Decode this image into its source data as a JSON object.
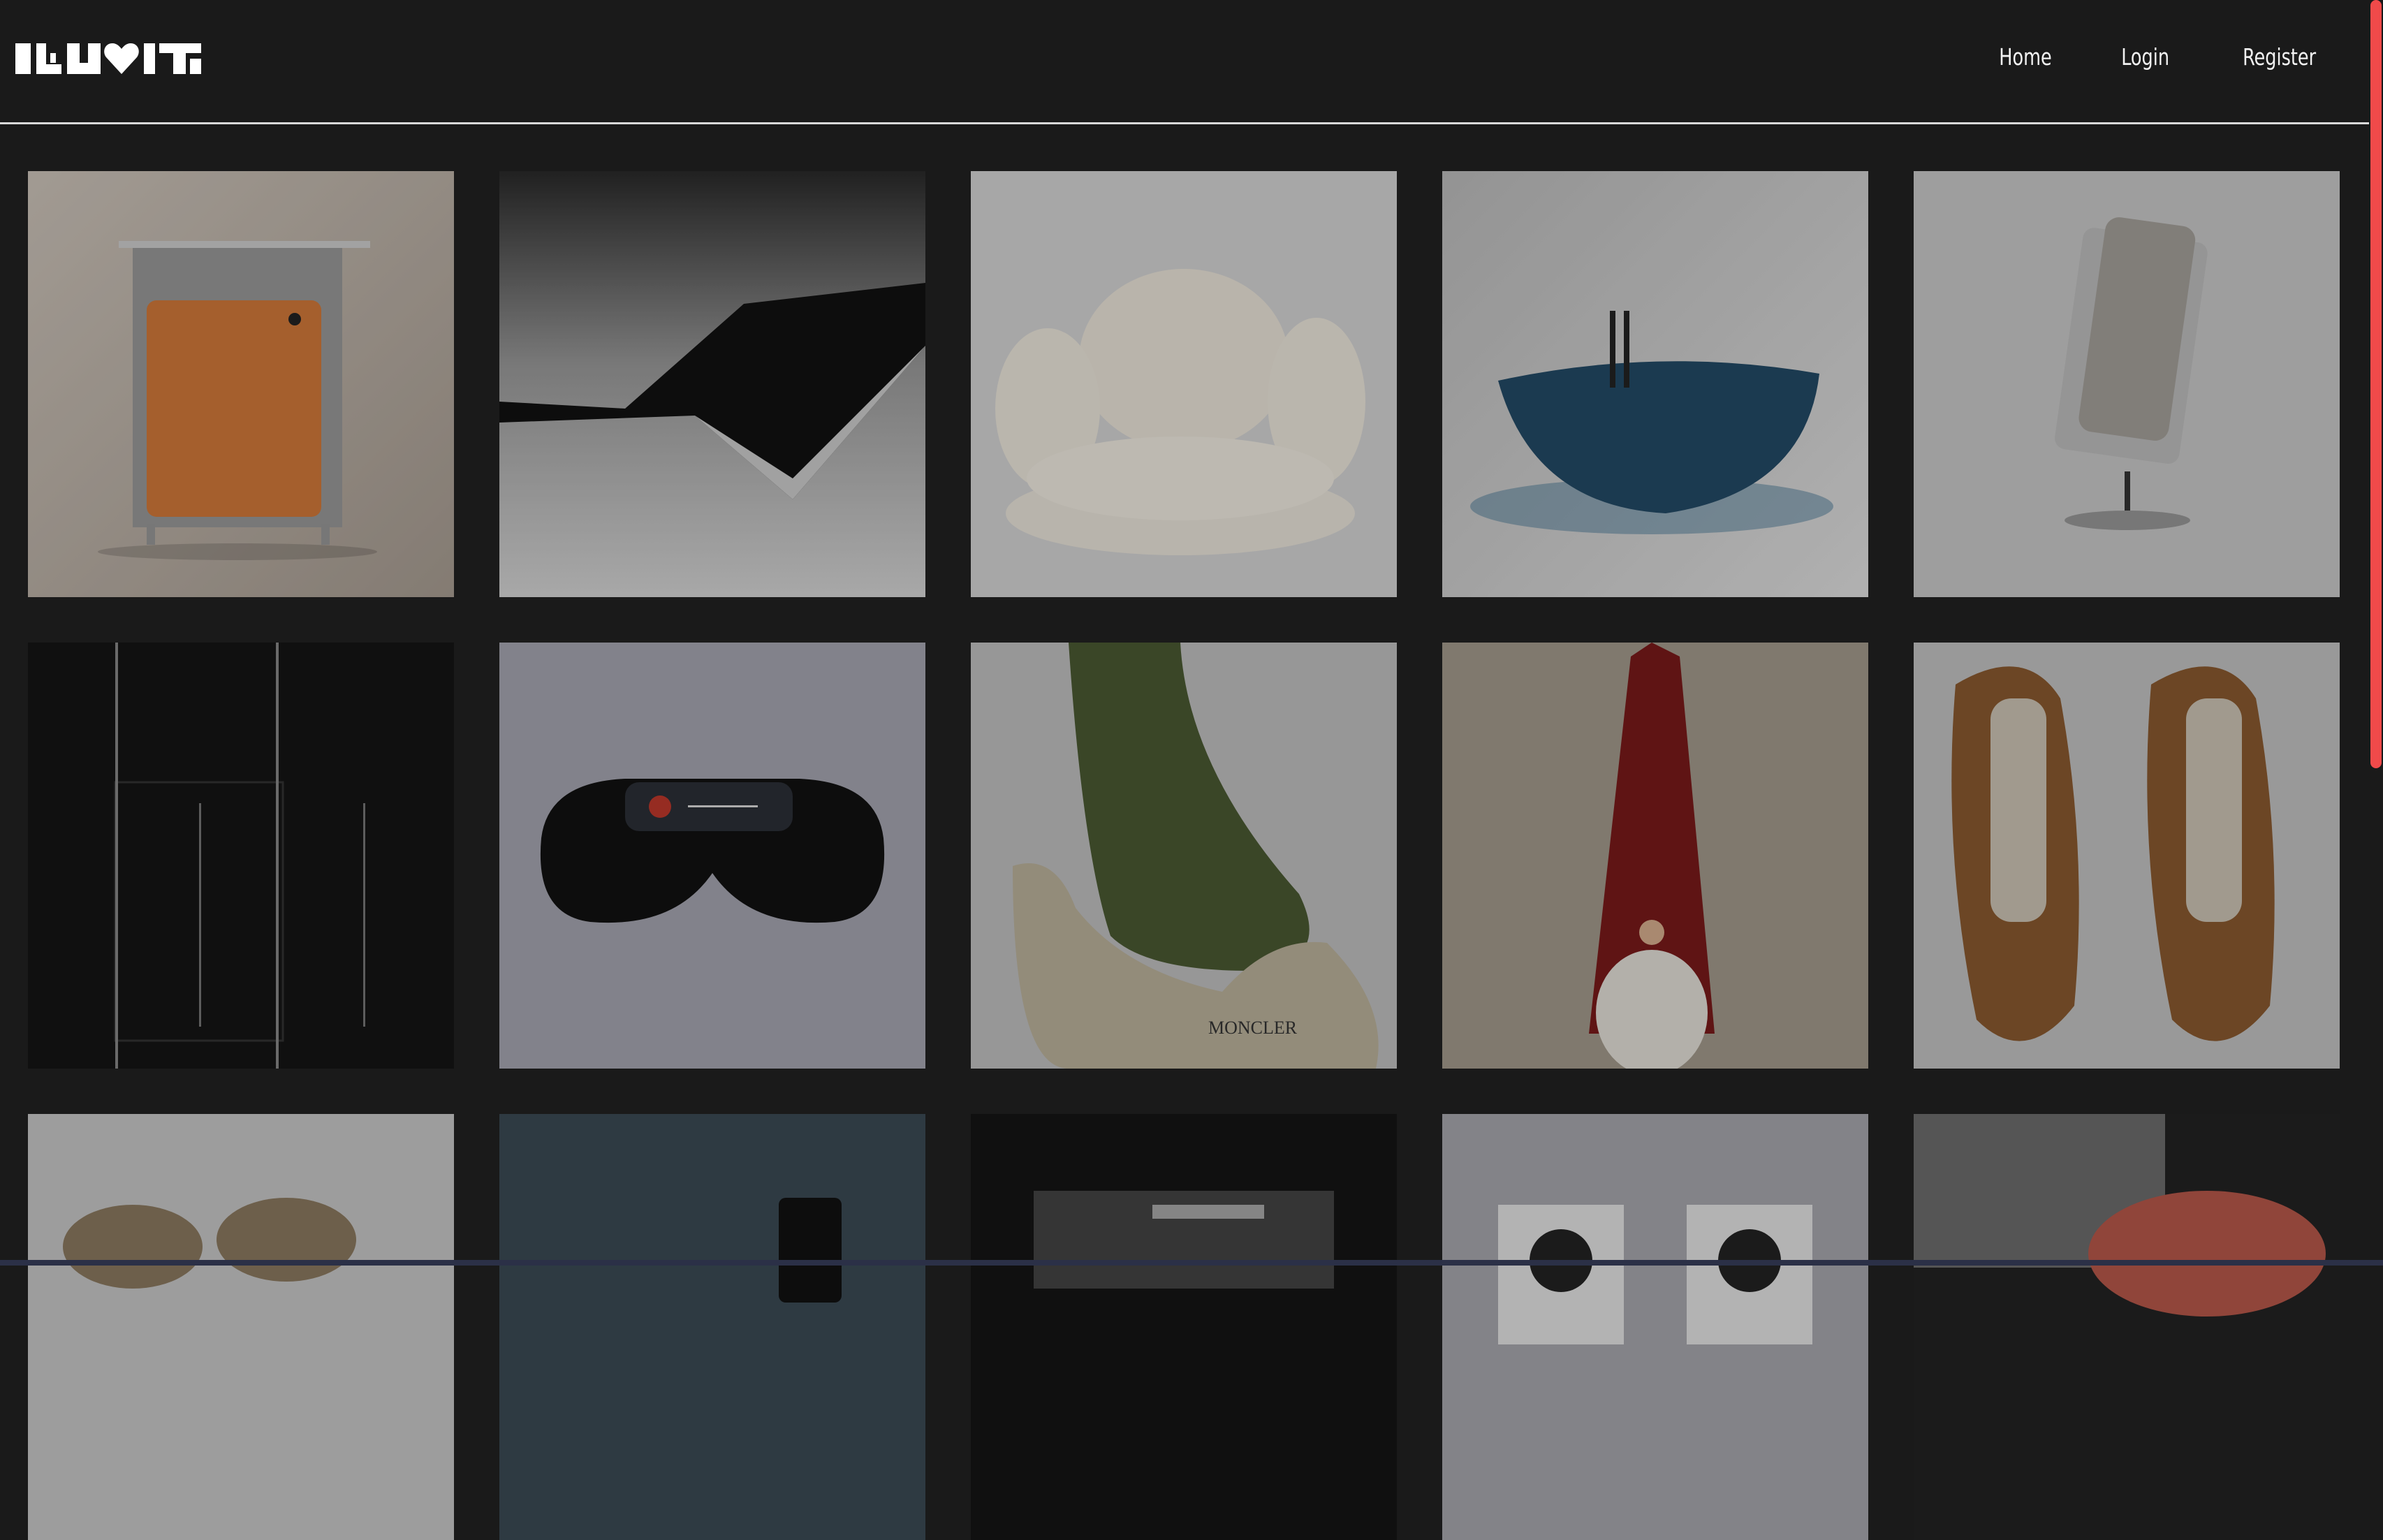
{
  "brand": {
    "logo_text": "ILUVIT"
  },
  "nav": {
    "items": [
      {
        "label": "Home"
      },
      {
        "label": "Login"
      },
      {
        "label": "Register"
      }
    ]
  },
  "gallery": {
    "items": [
      {
        "subject": "orange-cabinet"
      },
      {
        "subject": "black-lounger"
      },
      {
        "subject": "cream-puffy-armchair"
      },
      {
        "subject": "blue-bathtub"
      },
      {
        "subject": "cylindrical-lamp"
      },
      {
        "subject": "dark-light-installation"
      },
      {
        "subject": "vr-goggles"
      },
      {
        "subject": "olive-sock-boot",
        "print_text": "MONCLER"
      },
      {
        "subject": "red-gnome"
      },
      {
        "subject": "brown-sneakers"
      },
      {
        "subject": "snakeskin-shoes"
      },
      {
        "subject": "dark-radio"
      },
      {
        "subject": "turntable"
      },
      {
        "subject": "speakers"
      },
      {
        "subject": "pink-object"
      }
    ]
  },
  "colors": {
    "background": "#1a1a1a",
    "text": "#f2f2f2",
    "accent": "#f04a4a"
  }
}
